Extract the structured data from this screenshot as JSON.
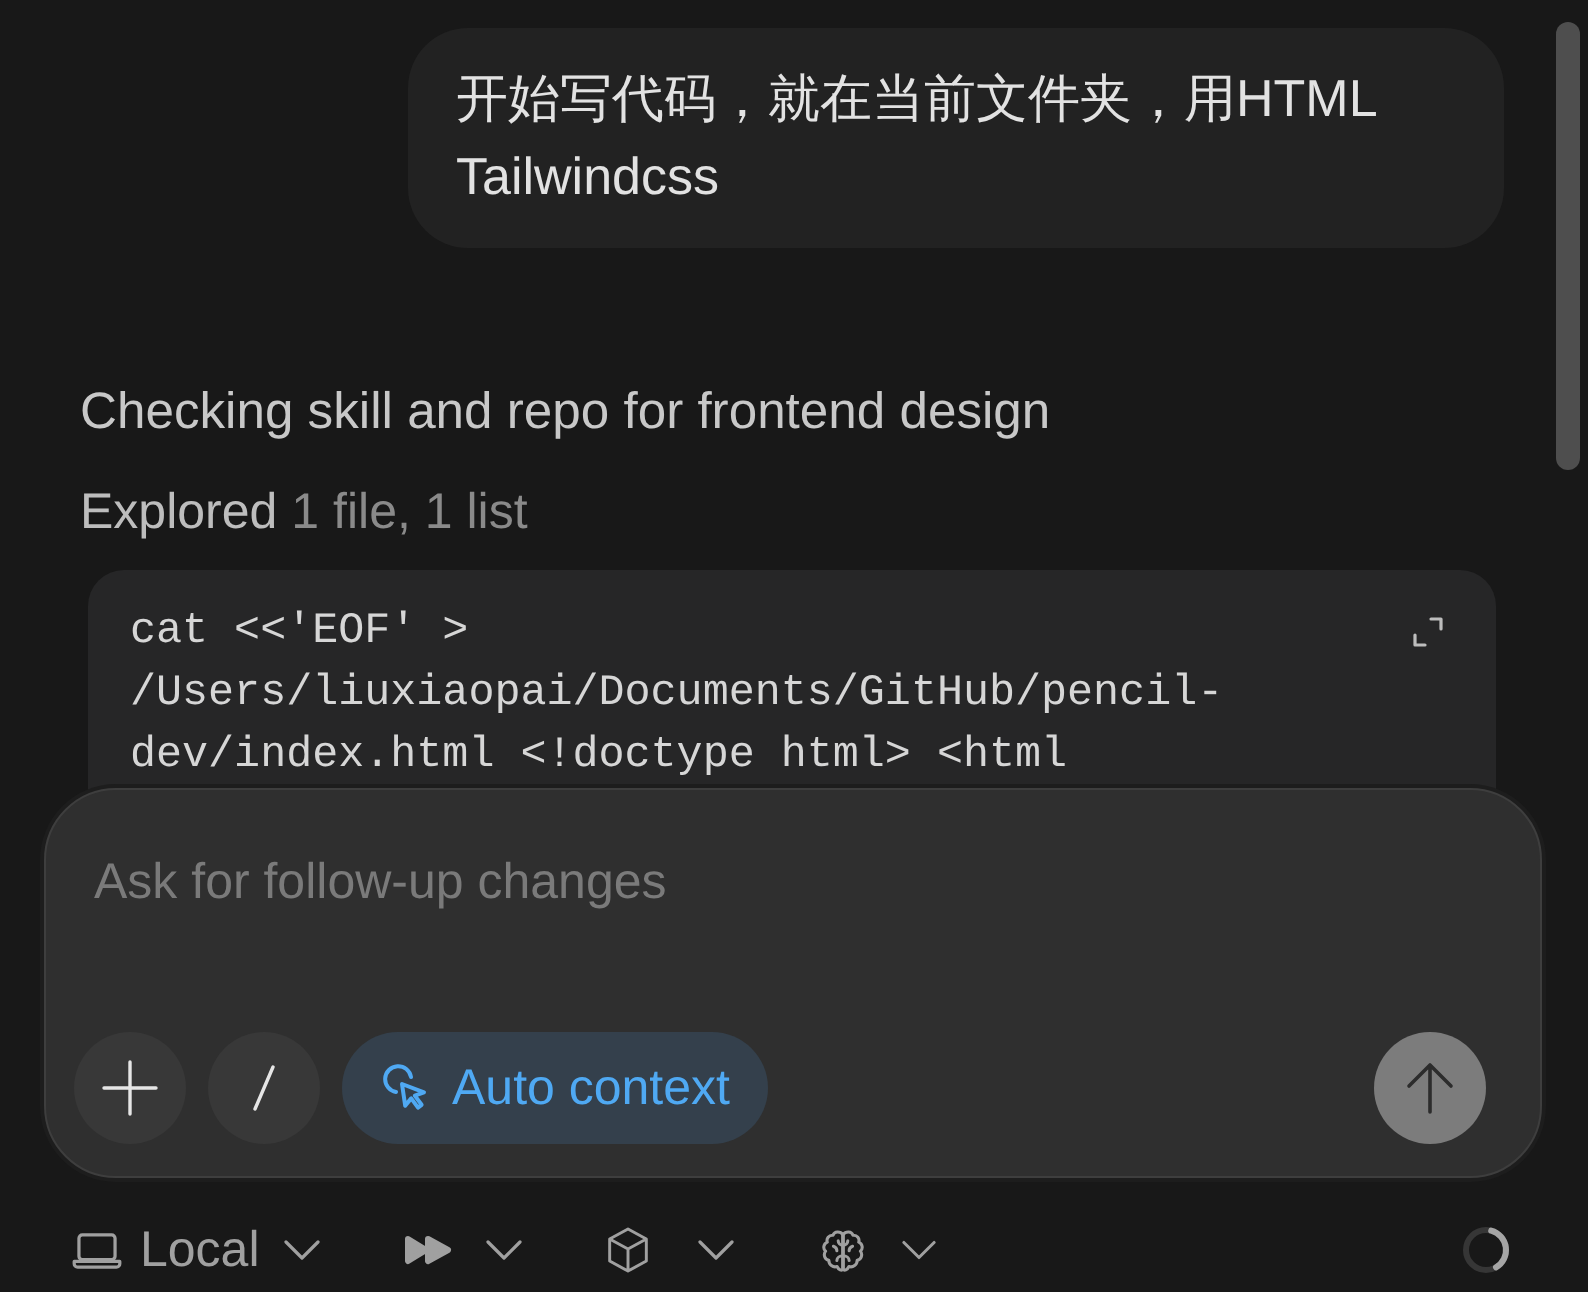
{
  "user_message": {
    "text": "开始写代码，就在当前文件夹，用HTML Tailwindcss"
  },
  "status_text": "Checking skill and repo for frontend design",
  "explored": {
    "label": "Explored",
    "detail": "1 file, 1 list"
  },
  "code_block": {
    "text": "cat <<'EOF' > /Users/liuxiaopai/Documents/GitHub/pencil-dev/index.html <!doctype html> <html"
  },
  "composer": {
    "placeholder": "Ask for follow-up changes",
    "buttons": [
      {
        "kind": "plus"
      },
      {
        "kind": "slash"
      },
      {
        "kind": "toggle",
        "label": "Auto context",
        "on": true
      }
    ],
    "send_button": {
      "disabled": true
    }
  },
  "bottom_bar": {
    "items": [
      {
        "kind": "laptop",
        "label": "Local"
      },
      {
        "kind": "fast-forward"
      },
      {
        "kind": "cube"
      },
      {
        "kind": "brain"
      }
    ]
  }
}
